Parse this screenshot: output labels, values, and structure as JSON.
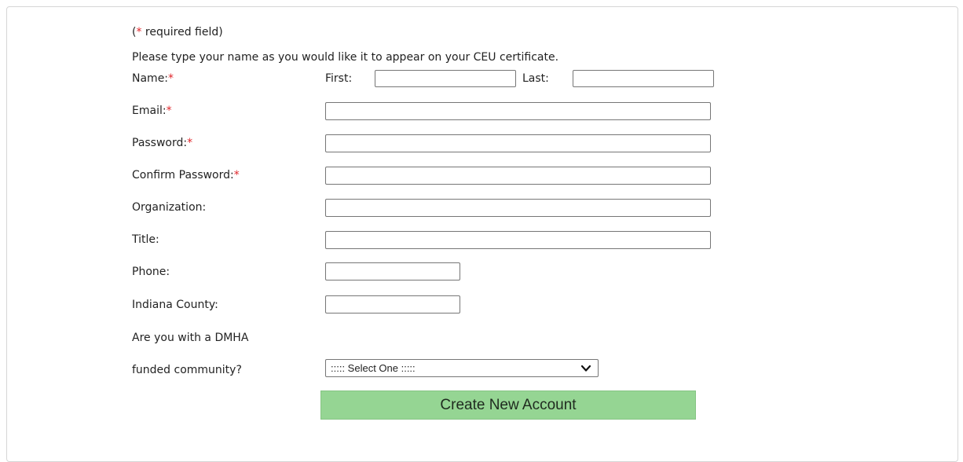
{
  "form": {
    "required_note": {
      "open": "(",
      "star": "*",
      "text": " required field)"
    },
    "instruction": "Please type your name as you would like it to appear on your CEU certificate.",
    "name": {
      "label": "Name:",
      "star": "*",
      "first_label": "First:",
      "first_value": "",
      "last_label": "Last:",
      "last_value": ""
    },
    "email": {
      "label": "Email:",
      "star": "*",
      "value": ""
    },
    "password": {
      "label": "Password:",
      "star": "*",
      "value": ""
    },
    "confirm_password": {
      "label": "Confirm Password:",
      "star": "*",
      "value": ""
    },
    "organization": {
      "label": "Organization:",
      "value": ""
    },
    "title": {
      "label": "Title:",
      "value": ""
    },
    "phone": {
      "label": "Phone:",
      "value": ""
    },
    "county": {
      "label": "Indiana County:",
      "value": ""
    },
    "dmha": {
      "label_line1": "Are you with a DMHA",
      "label_line2": "funded community?",
      "selected": "::::: Select One :::::"
    },
    "submit_label": "Create New Account"
  },
  "colors": {
    "required_star": "#e0262b",
    "button_bg": "#95d593",
    "border": "#d6d6d6"
  },
  "icons": {
    "select_arrow": "chevron-down-icon"
  }
}
